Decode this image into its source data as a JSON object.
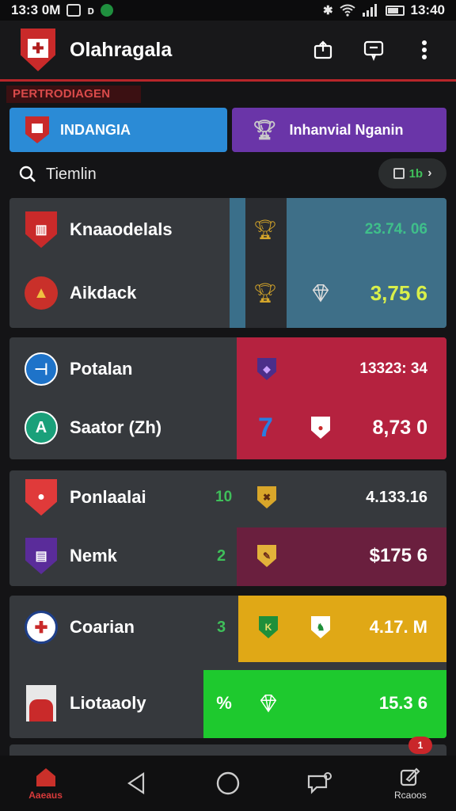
{
  "status_bar": {
    "time_left": "13:3 0M",
    "time_right": "13:40",
    "icons": [
      "notification-icon",
      "d-icon",
      "app-icon",
      "bluetooth-icon",
      "wifi-icon",
      "signal-icon",
      "battery-icon"
    ]
  },
  "app_bar": {
    "title": "Olahragala",
    "icons": [
      "share-icon",
      "message-icon",
      "more-icon"
    ]
  },
  "section_tag": "PERTRODIAGEN",
  "tabs": [
    {
      "label": "INDANGIA",
      "icon": "crest-icon",
      "color": "#2b8bd6"
    },
    {
      "label": "Inhanvial Nganin",
      "icon": "trophy-icon",
      "color": "#6a35a8"
    }
  ],
  "search": {
    "text": "Tiemlin",
    "filter_label": "1b"
  },
  "matches": [
    {
      "rows": [
        {
          "team": "Knaaodelals",
          "value": "23.74. 06",
          "value_color": "#3fbf8a",
          "icon": "trophy-icon"
        },
        {
          "team": "Aikdack",
          "value": "3,75 6",
          "value_color": "#d9ef4a",
          "icon": "trophy-icon"
        }
      ]
    },
    {
      "rows": [
        {
          "team": "Potalan",
          "value": "13323: 34",
          "value_color": "#ffffff"
        },
        {
          "team": "Saator (Zh)",
          "score": "7",
          "value": "8,73 0",
          "value_color": "#ffffff"
        }
      ]
    },
    {
      "rows": [
        {
          "team": "Ponlaalai",
          "score": "10",
          "value": "4.133.16",
          "value_color": "#ffffff"
        },
        {
          "team": "Nemk",
          "score": "2",
          "value": "$175 6",
          "value_color": "#ffffff"
        }
      ]
    },
    {
      "rows": [
        {
          "team": "Coarian",
          "score": "3",
          "value": "4.17. M",
          "value_color": "#ffffff"
        },
        {
          "team": "Liotaaoly",
          "value": "15.3 6",
          "value_color": "#ffffff"
        }
      ]
    }
  ],
  "badge": "1",
  "nav": [
    {
      "label": "Aaeaus",
      "icon": "home-icon",
      "active": true
    },
    {
      "label": "",
      "icon": "back-icon"
    },
    {
      "label": "",
      "icon": "circle-home-icon"
    },
    {
      "label": "",
      "icon": "chat-icon"
    },
    {
      "label": "Rcaoos",
      "icon": "edit-icon"
    }
  ]
}
